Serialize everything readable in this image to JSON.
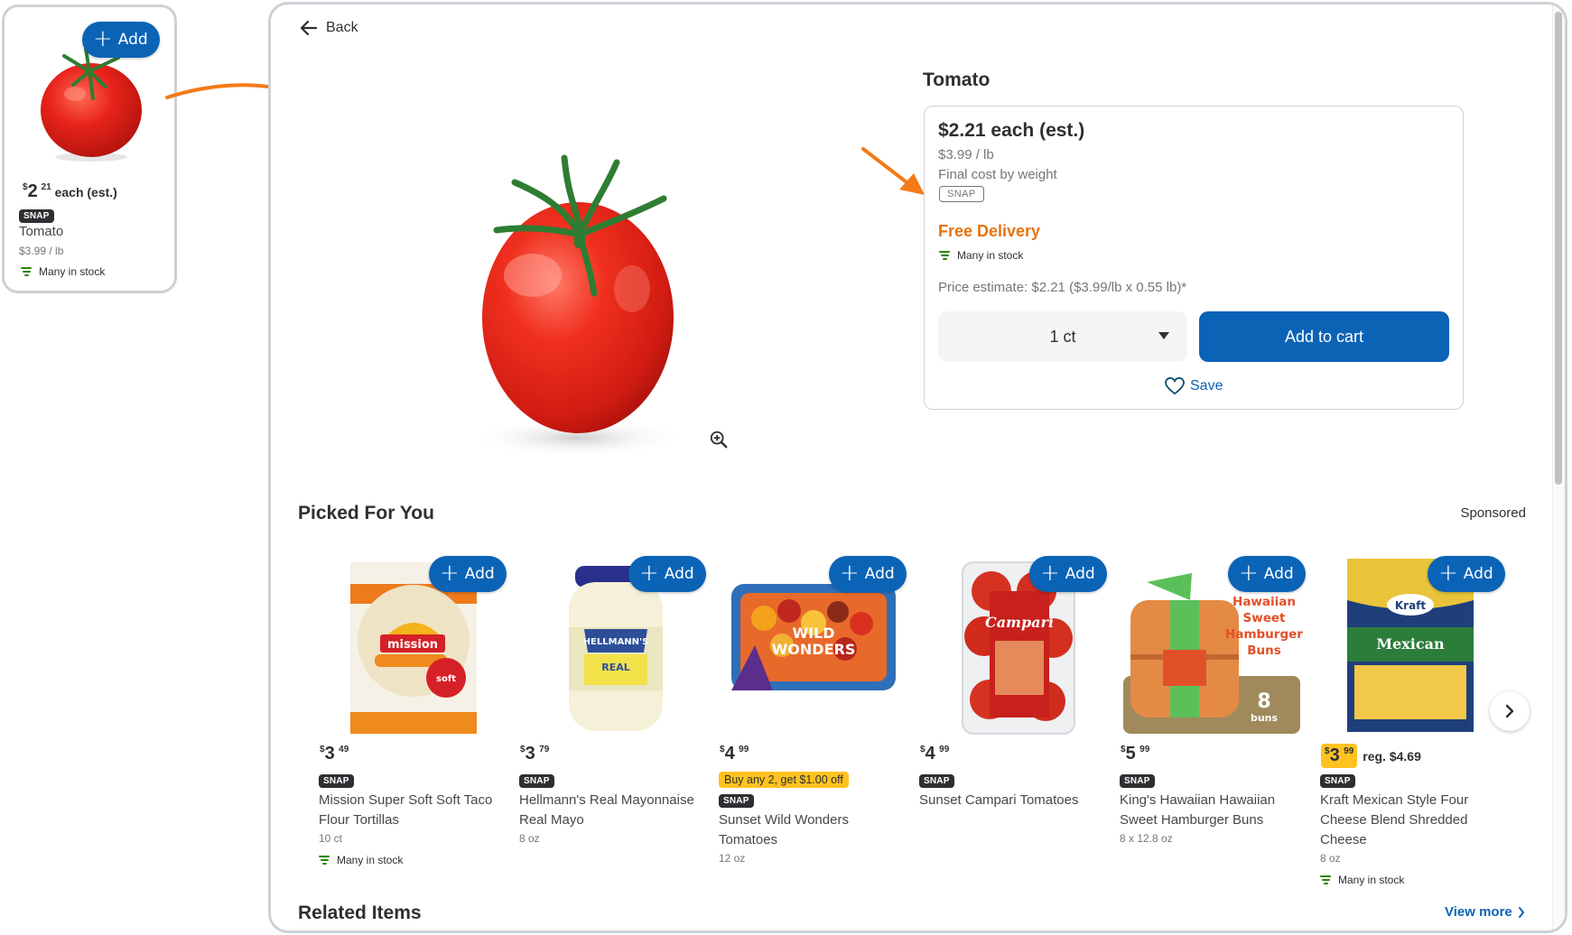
{
  "mini_card": {
    "add_label": "Add",
    "price_dollar_sign": "$",
    "price_whole": "2",
    "price_cents": "21",
    "price_suffix": "each (est.)",
    "snap_label": "SNAP",
    "name": "Tomato",
    "unit_price": "$3.99 / lb",
    "stock": "Many in stock"
  },
  "header": {
    "back_label": "Back"
  },
  "product_detail": {
    "title": "Tomato",
    "price": "$2.21 each (est.)",
    "unit_price": "$3.99 / lb",
    "final_cost_note": "Final cost by weight",
    "snap_label": "SNAP",
    "delivery": "Free Delivery",
    "stock": "Many in stock",
    "price_estimate": "Price estimate: $2.21 ($3.99/lb x 0.55 lb)*",
    "quantity_selected": "1 ct",
    "add_to_cart_label": "Add to cart",
    "save_label": "Save"
  },
  "colors": {
    "brand_blue": "#0b63b6",
    "delivery_orange": "#e8730e",
    "stock_green": "#2a8703",
    "promo_yellow": "#ffc220",
    "annotation_orange": "#f47a18"
  },
  "picked_for_you": {
    "title": "Picked For You",
    "sponsored_label": "Sponsored",
    "add_label": "Add",
    "products": [
      {
        "dollar": "$",
        "whole": "3",
        "cents": "49",
        "promo": "",
        "snap": "SNAP",
        "name": "Mission Super Soft Soft Taco Flour Tortillas",
        "size": "10 ct",
        "stock": "Many in stock",
        "reg_price": ""
      },
      {
        "dollar": "$",
        "whole": "3",
        "cents": "79",
        "promo": "",
        "snap": "SNAP",
        "name": "Hellmann's Real Mayonnaise Real Mayo",
        "size": "8 oz",
        "stock": "",
        "reg_price": ""
      },
      {
        "dollar": "$",
        "whole": "4",
        "cents": "99",
        "promo": "Buy any 2, get $1.00 off",
        "snap": "SNAP",
        "name": "Sunset Wild Wonders Tomatoes",
        "size": "12 oz",
        "stock": "",
        "reg_price": ""
      },
      {
        "dollar": "$",
        "whole": "4",
        "cents": "99",
        "promo": "",
        "snap": "SNAP",
        "name": "Sunset Campari Tomatoes",
        "size": "",
        "stock": "",
        "reg_price": ""
      },
      {
        "dollar": "$",
        "whole": "5",
        "cents": "99",
        "promo": "",
        "snap": "SNAP",
        "name": "King's Hawaiian Hawaiian Sweet Hamburger Buns",
        "size": "8 x 12.8 oz",
        "stock": "",
        "reg_price": "",
        "image_text": [
          "Hawaiian",
          "Sweet",
          "Hamburger",
          "Buns"
        ],
        "image_count": "8",
        "image_count_unit": "buns"
      },
      {
        "dollar": "$",
        "whole": "3",
        "cents": "99",
        "promo": "",
        "snap": "SNAP",
        "name": "Kraft Mexican Style Four Cheese Blend Shredded Cheese",
        "size": "8 oz",
        "stock": "Many in stock",
        "reg_price": "reg. $4.69"
      }
    ]
  },
  "related_items": {
    "title": "Related Items",
    "view_more_label": "View more"
  }
}
